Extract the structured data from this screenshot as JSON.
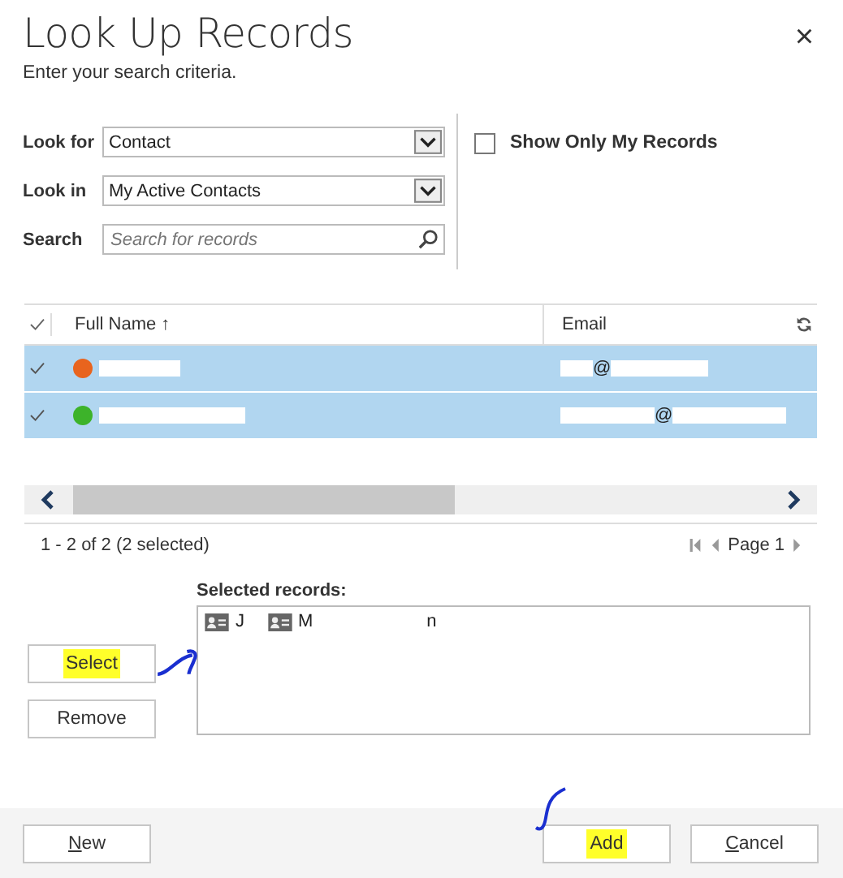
{
  "dialog": {
    "title": "Look Up Records",
    "subtitle": "Enter your search criteria.",
    "close": "×"
  },
  "form": {
    "look_for": {
      "label": "Look for",
      "value": "Contact"
    },
    "look_in": {
      "label": "Look in",
      "value": "My Active Contacts"
    },
    "search": {
      "label": "Search",
      "placeholder": "Search for records"
    },
    "show_only_mine": {
      "label": "Show Only My Records",
      "checked": false
    }
  },
  "grid": {
    "columns": [
      "Full Name ↑",
      "Email"
    ],
    "rows": [
      {
        "selected": true,
        "color": "#e8641e",
        "email_at": "@"
      },
      {
        "selected": true,
        "color": "#3db32a",
        "email_at": "@"
      }
    ],
    "summary": "1 - 2 of 2 (2 selected)",
    "page": "Page 1"
  },
  "selected_records": {
    "label": "Selected records:",
    "items": [
      {
        "fragments": [
          "J"
        ]
      },
      {
        "fragments": [
          "M",
          "n"
        ]
      }
    ]
  },
  "buttons": {
    "select": {
      "label": "Select",
      "highlighted": true
    },
    "remove": {
      "label": "Remove",
      "highlighted": false
    }
  },
  "footer": [
    {
      "label": "New",
      "mnemonic": true,
      "highlighted": false
    },
    {
      "label": "Add",
      "mnemonic": false,
      "highlighted": true
    },
    {
      "label": "Cancel",
      "mnemonic": true,
      "highlighted": false
    }
  ]
}
